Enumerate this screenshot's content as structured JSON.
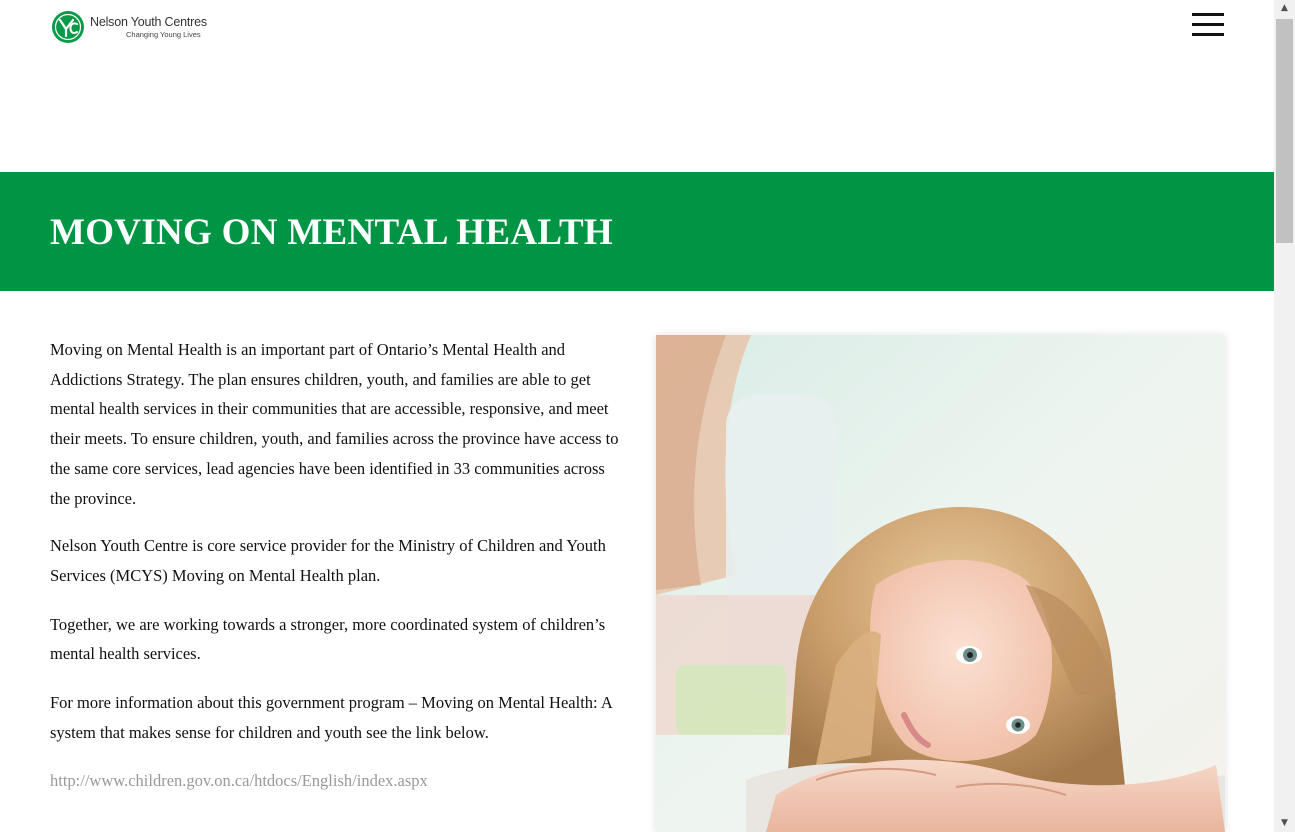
{
  "header": {
    "logo_name": "Nelson Youth Centres",
    "logo_tagline": "Changing Young Lives",
    "logo_mark_icon": "nyc-logo-mark",
    "menu_icon": "hamburger-menu-icon"
  },
  "banner": {
    "title": "MOVING ON MENTAL HEALTH",
    "background": "#009544"
  },
  "content": {
    "paragraphs": [
      "Moving on Mental Health is an important part of Ontario’s Mental Health and Addictions Strategy. The plan ensures children, youth, and families are able to get mental health services in their communities that are accessible, responsive, and meet their meets. To ensure children, youth, and families across the province have access to the same core services, lead agencies have been identified in 33 communities across the province.",
      "Nelson Youth Centre is core service provider for the Ministry of Children and Youth Services (MCYS) Moving on Mental Health plan.",
      "Together, we are working towards a stronger, more coordinated system of children’s mental health services.",
      "For more information about this government program – Moving on Mental Health: A system that makes sense for children and youth see the link below."
    ],
    "link": "http://www.children.gov.on.ca/htdocs/English/index.aspx"
  },
  "scrollbar": {
    "up_arrow": "▲",
    "down_arrow": "▼"
  },
  "colors": {
    "brand_green": "#009544",
    "link_gray": "#999999"
  }
}
